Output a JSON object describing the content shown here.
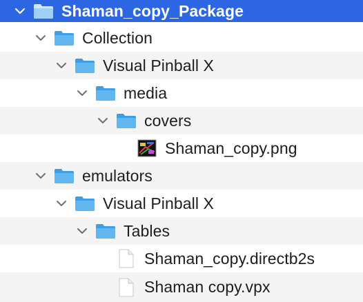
{
  "tree": {
    "root": {
      "label": "Shaman_copy_Package",
      "icon": "folder-icon",
      "expanded": true,
      "selected": true
    },
    "collection": {
      "label": "Collection",
      "icon": "folder-icon",
      "expanded": true
    },
    "collection_vpx": {
      "label": "Visual Pinball X",
      "icon": "folder-icon",
      "expanded": true
    },
    "media": {
      "label": "media",
      "icon": "folder-icon",
      "expanded": true
    },
    "covers": {
      "label": "covers",
      "icon": "folder-icon",
      "expanded": true
    },
    "cover_png": {
      "label": "Shaman_copy.png",
      "icon": "image-thumbnail-icon"
    },
    "emulators": {
      "label": "emulators",
      "icon": "folder-icon",
      "expanded": true
    },
    "emulators_vpx": {
      "label": "Visual Pinball X",
      "icon": "folder-icon",
      "expanded": true
    },
    "tables": {
      "label": "Tables",
      "icon": "folder-icon",
      "expanded": true
    },
    "directb2s": {
      "label": "Shaman_copy.directb2s",
      "icon": "document-icon"
    },
    "vpx": {
      "label": "Shaman copy.vpx",
      "icon": "document-icon"
    }
  },
  "colors": {
    "selection": "#2d66e3",
    "folder": "#5aaeea",
    "stripe": "#f4f4f5",
    "text": "#1d1d1f"
  }
}
